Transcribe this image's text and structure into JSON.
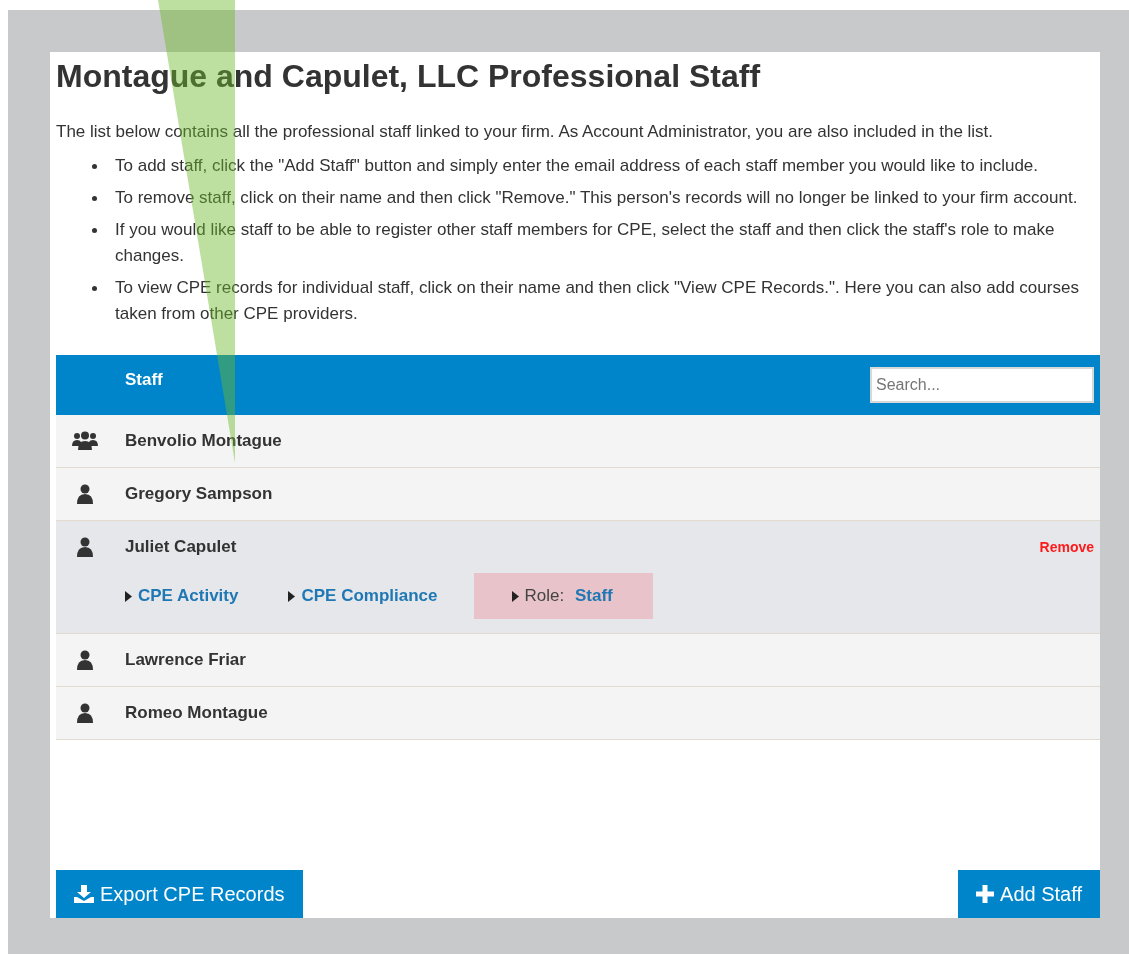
{
  "title": "Montague and Capulet, LLC Professional Staff",
  "intro": "The list below contains all the professional staff linked to your firm. As Account Administrator, you are also included in the list.",
  "bullets": [
    "To add staff, click the \"Add Staff\" button and simply enter the email address of each staff member you would like to include.",
    "To remove staff, click on their name and then click \"Remove.\" This person's records will no longer be linked to your firm account.",
    "If you would like staff to be able to register other staff members for CPE, select the staff and then click the staff's role to make changes.",
    "To view CPE records for individual staff, click on their name and then click \"View CPE Records.\". Here you can also add courses taken from other CPE providers."
  ],
  "table": {
    "column": "Staff",
    "search": {
      "placeholder": "Search..."
    },
    "rows": [
      {
        "kind": "group",
        "name": "Benvolio Montague",
        "expanded": false
      },
      {
        "kind": "person",
        "name": "Gregory Sampson",
        "expanded": false
      },
      {
        "kind": "person",
        "name": "Juliet Capulet",
        "expanded": true,
        "remove": "Remove",
        "links": [
          {
            "label": "CPE Activity",
            "selected": false
          },
          {
            "label": "CPE Compliance",
            "selected": false
          },
          {
            "prefix": "Role:",
            "label": "Staff",
            "selected": true
          }
        ]
      },
      {
        "kind": "person",
        "name": "Lawrence Friar",
        "expanded": false
      },
      {
        "kind": "person",
        "name": "Romeo Montague",
        "expanded": false
      }
    ]
  },
  "buttons": [
    {
      "kind": "export",
      "label": "Export CPE Records"
    },
    {
      "kind": "add",
      "label": "Add Staff"
    }
  ]
}
